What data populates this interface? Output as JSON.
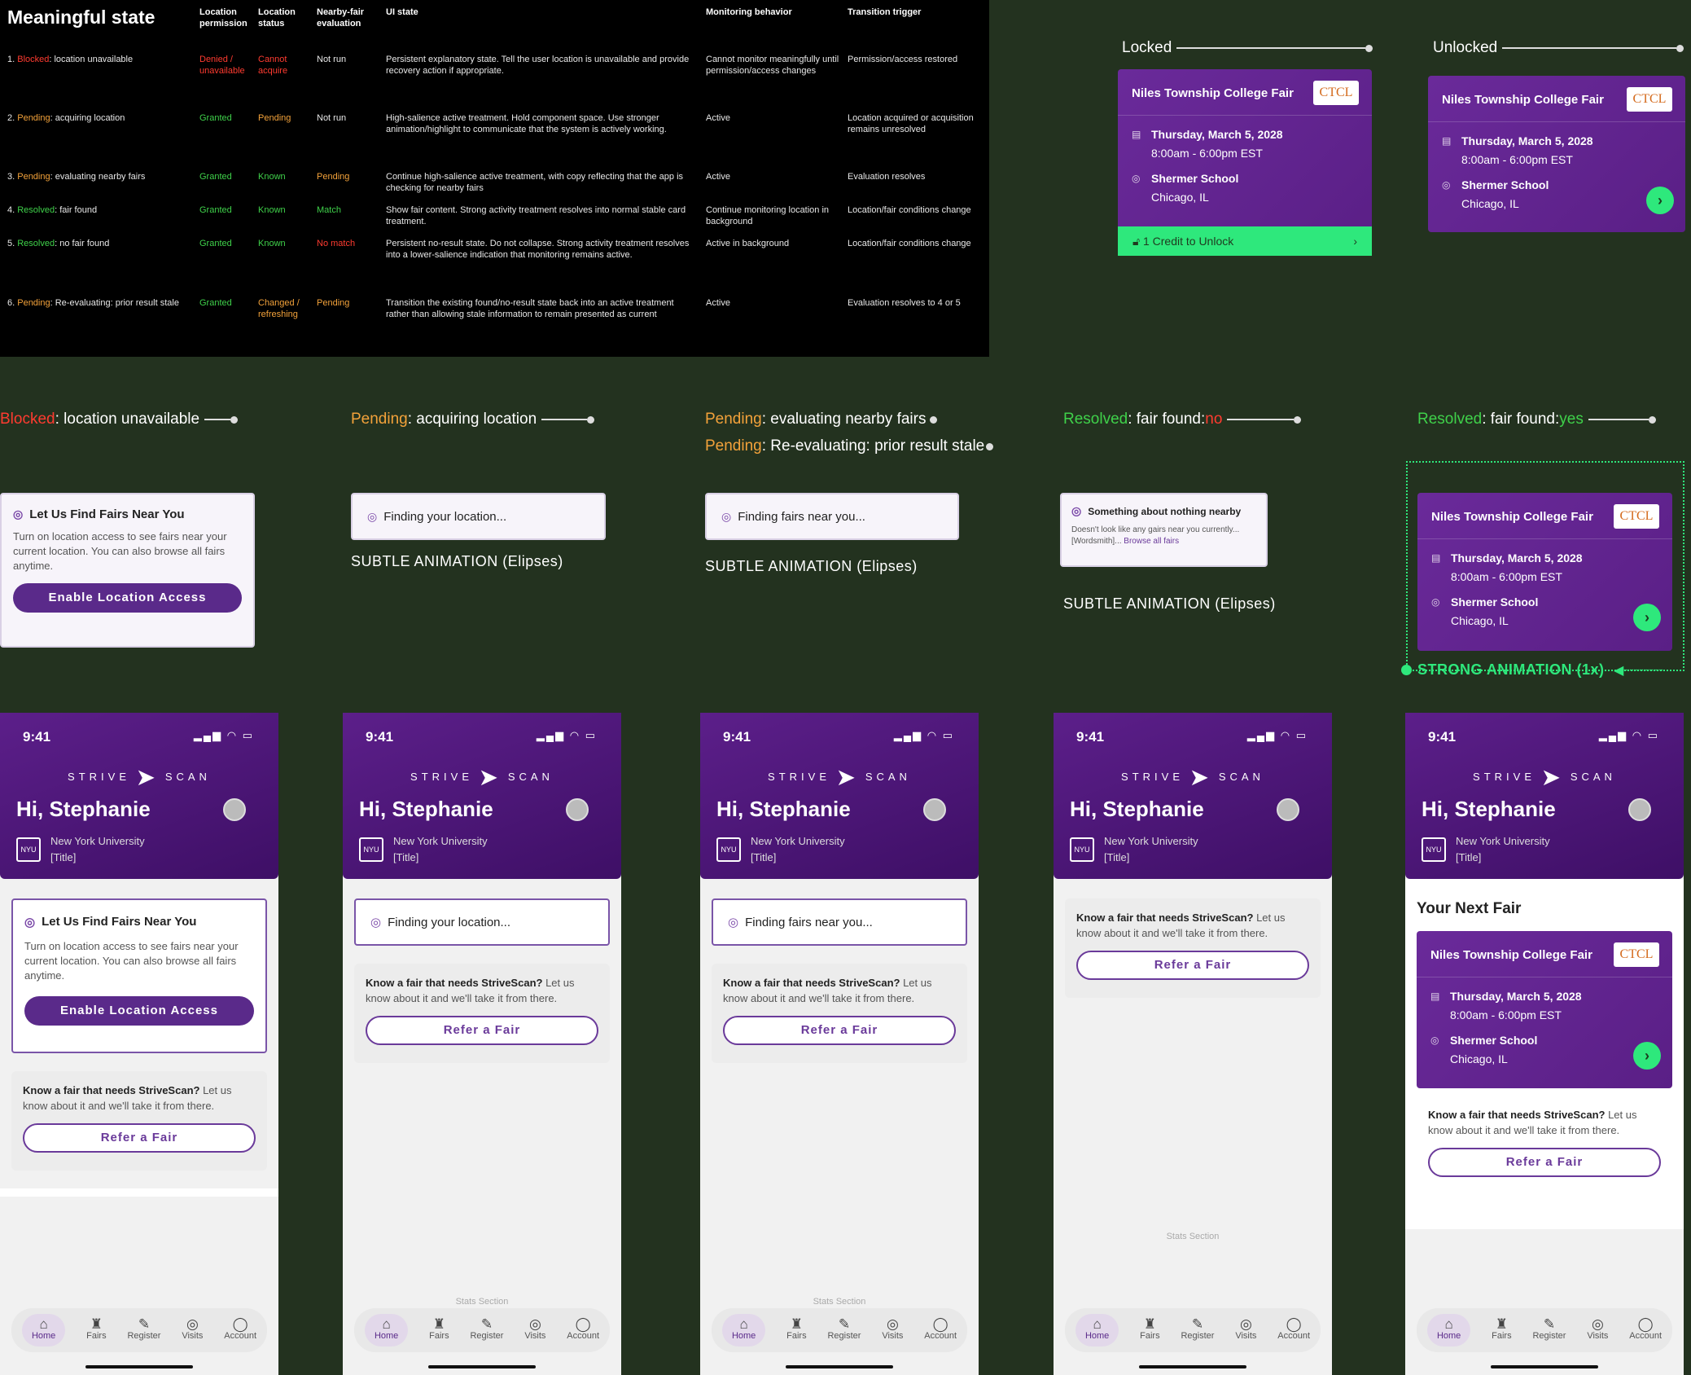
{
  "table": {
    "title": "Meaningful state",
    "headers": [
      "Location permission",
      "Location status",
      "Nearby-fair evaluation",
      "UI state",
      "Monitoring behavior",
      "Transition trigger"
    ],
    "rows": [
      {
        "num": "1. ",
        "tag": "Blocked",
        "rest": ": location unavailable",
        "perm": "Denied / unavailable",
        "status": "Cannot acquire",
        "eval": "Not run",
        "ui": "Persistent explanatory state. Tell the user location is unavailable and provide recovery action if appropriate.",
        "mon": "Cannot monitor meaningfully until permission/access changes",
        "trig": "Permission/access restored"
      },
      {
        "num": "2. ",
        "tag": "Pending",
        "rest": ": acquiring location",
        "perm": "Granted",
        "status": "Pending",
        "eval": "Not run",
        "ui": "High-salience active treatment. Hold component space. Use stronger animation/highlight to communicate that the system is actively working.",
        "mon": "Active",
        "trig": "Location acquired or acquisition remains unresolved"
      },
      {
        "num": "3. ",
        "tag": "Pending",
        "rest": ": evaluating nearby fairs",
        "perm": "Granted",
        "status": "Known",
        "eval": "Pending",
        "ui": "Continue high-salience active treatment, with copy reflecting that the app is checking for nearby fairs",
        "mon": "Active",
        "trig": "Evaluation resolves"
      },
      {
        "num": "4. ",
        "tag": "Resolved",
        "rest": ": fair found",
        "perm": "Granted",
        "status": "Known",
        "eval": "Match",
        "ui": "Show fair content. Strong activity treatment resolves into normal stable card treatment.",
        "mon": "Continue monitoring location in background",
        "trig": "Location/fair conditions change"
      },
      {
        "num": "5. ",
        "tag": "Resolved",
        "rest": ": no fair found",
        "perm": "Granted",
        "status": "Known",
        "eval": "No match",
        "ui": "Persistent no-result state. Do not collapse. Strong activity treatment resolves into a lower-salience indication that monitoring remains active.",
        "mon": "Active in background",
        "trig": "Location/fair conditions change"
      },
      {
        "num": "6. ",
        "tag": "Pending",
        "rest": ": Re-evaluating: prior result stale",
        "perm": "Granted",
        "status": "Changed / refreshing",
        "eval": "Pending",
        "ui": "Transition the existing found/no-result state back into an active treatment rather than allowing stale information to remain presented as current",
        "mon": "Active",
        "trig": "Evaluation resolves to 4 or 5"
      }
    ]
  },
  "locked": {
    "heading": "Locked",
    "credit": "1 Credit to Unlock"
  },
  "unlocked": {
    "heading": "Unlocked"
  },
  "fair": {
    "name": "Niles Township College Fair",
    "logo": "CTCL",
    "date": "Thursday, March 5, 2028",
    "time": "8:00am - 6:00pm EST",
    "venue": "Shermer School",
    "city": "Chicago, IL"
  },
  "states": {
    "s1": {
      "tag": "Blocked",
      "rest": ": location unavailable"
    },
    "s2": {
      "tag": "Pending",
      "rest": ": acquiring location"
    },
    "s3": {
      "tag": "Pending",
      "rest": ": evaluating nearby fairs"
    },
    "s3b": {
      "tag": "Pending",
      "rest": ": Re-evaluating: prior result stale"
    },
    "s4": {
      "tag": "Resolved",
      "rest": ": fair found: ",
      "val": "no"
    },
    "s5": {
      "tag": "Resolved",
      "rest": ": fair found: ",
      "val": "yes"
    }
  },
  "labels": {
    "subtle": "SUBTLE ANIMATION (Elipses)",
    "strong": "STRONG ANIMATION (1x)"
  },
  "cards": {
    "find_title": "Let Us Find Fairs Near You",
    "find_body": "Turn on location access to see fairs near your current location. You can also browse all fairs anytime.",
    "enable": "Enable Location Access",
    "finding_loc": "Finding your location...",
    "finding_fairs": "Finding fairs near you...",
    "nothing_title": "Something about nothing nearby",
    "nothing_body": "Doesn't look like any gairs near you currently... [Wordsmith]... ",
    "browse": "Browse all fairs"
  },
  "phone": {
    "time": "9:41",
    "logo_left": "STRIVE",
    "logo_right": "SCAN",
    "greeting": "Hi, Stephanie",
    "uni": "New York University",
    "title": "[Title]",
    "nyu": "NYU",
    "refer_bold": "Know a fair that needs StriveScan?",
    "refer_rest": " Let us know about it and we'll take it from there.",
    "refer_btn": "Refer a Fair",
    "stats": "Stats Section",
    "next": "Your Next Fair",
    "nav": [
      "Home",
      "Fairs",
      "Register",
      "Visits",
      "Account"
    ]
  },
  "colors": {
    "accent": "#5a2a8a",
    "go": "#2ee87c",
    "blocked": "#ff3b30",
    "pending": "#f3a23a",
    "resolved": "#3fd14a"
  }
}
